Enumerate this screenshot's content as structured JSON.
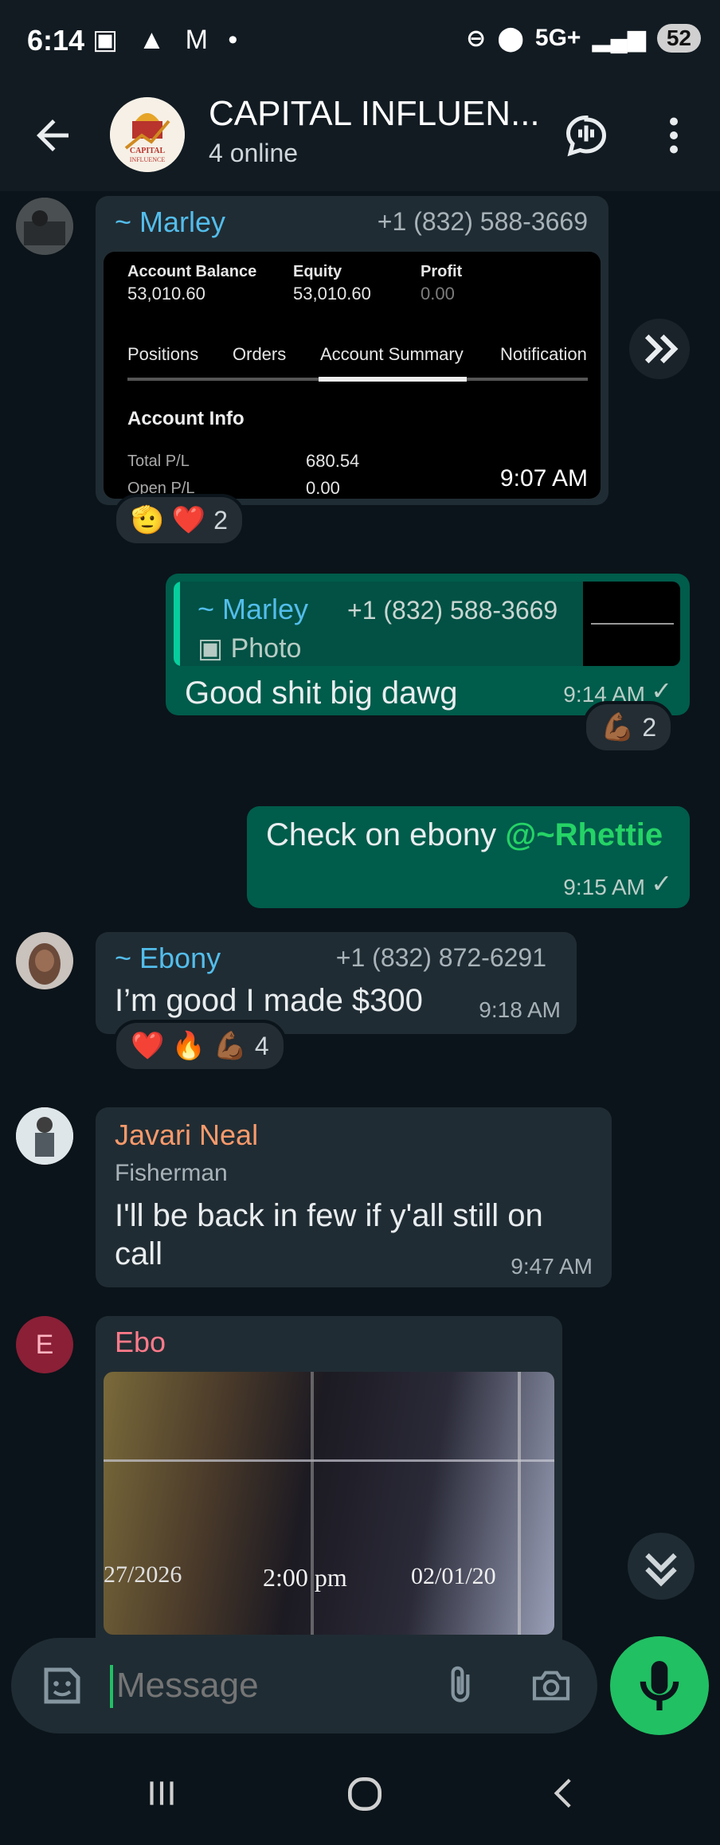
{
  "status": {
    "time": "6:14",
    "network": "5G+",
    "battery": "52"
  },
  "header": {
    "title": "CAPITAL INFLUEN...",
    "subtitle": "4 online",
    "avatar_text": "CAPITAL INFLUENCE"
  },
  "messages": [
    {
      "sender": "~ Marley",
      "phone": "+1 (832) 588-3669",
      "time": "9:07 AM",
      "screenshot": {
        "col1_label": "Account Balance",
        "col1_value": "53,010.60",
        "col2_label": "Equity",
        "col2_value": "53,010.60",
        "col3_label": "Profit",
        "col3_value": "0.00",
        "tabs": [
          "Positions",
          "Orders",
          "Account Summary",
          "Notification"
        ],
        "section": "Account Info",
        "row1_label": "Total P/L",
        "row1_value": "680.54",
        "row2_label": "Open P/L",
        "row2_value": "0.00"
      },
      "reactions": {
        "emojis": "🫡 ❤️",
        "count": "2"
      }
    },
    {
      "quote_sender": "~ Marley",
      "quote_phone": "+1 (832) 588-3669",
      "quote_type": "Photo",
      "text": "Good shit big dawg",
      "time": "9:14 AM",
      "reactions": {
        "emojis": "💪🏾",
        "count": "2"
      }
    },
    {
      "text": "Check on ebony ",
      "mention": "@~Rhettie",
      "time": "9:15 AM"
    },
    {
      "sender": "~ Ebony",
      "phone": "+1 (832) 872-6291",
      "text": "I’m good I made $300",
      "time": "9:18 AM",
      "reactions": {
        "emojis": "❤️ 🔥 💪🏾",
        "count": "4"
      }
    },
    {
      "sender": "Javari Neal",
      "role": "Fisherman",
      "text_line1": "I'll be back in few if y'all still on",
      "text_line2": "call",
      "time": "9:47 AM"
    },
    {
      "sender": "Ebo",
      "avatar_letter": "E",
      "photo_caption_left": "27/2026",
      "photo_caption_mid": "2:00 pm",
      "photo_caption_right": "02/01/20"
    }
  ],
  "input": {
    "placeholder": "Message"
  },
  "colors": {
    "accent": "#21c063",
    "out_bubble": "#005c4b",
    "in_bubble": "#202c33",
    "marley": "#53bdeb",
    "javari": "#fa9a6b",
    "ebo": "#ff7a8a"
  },
  "icons": [
    "back-arrow-icon",
    "voice-chat-icon",
    "more-vertical-icon",
    "forward-icon",
    "scroll-down-icon",
    "sticker-icon",
    "attach-icon",
    "camera-icon",
    "mic-icon",
    "image-icon",
    "check-icon"
  ]
}
